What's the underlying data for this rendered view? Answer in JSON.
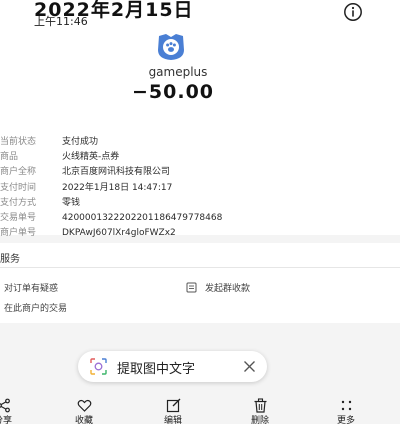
{
  "viewer": {
    "date": "2022年2月15日",
    "time": "上午11:46",
    "info_icon": "info-icon"
  },
  "receipt": {
    "merchant_name": "gameplus",
    "amount": "−50.00",
    "logo_color": "#4a7fd4",
    "rows": [
      {
        "label": "当前状态",
        "value": "支付成功"
      },
      {
        "label": "商品",
        "value": "火线精英-点券"
      },
      {
        "label": "商户全称",
        "value": "北京百度网讯科技有限公司"
      },
      {
        "label": "支付时间",
        "value": "2022年1月18日 14:47:17"
      },
      {
        "label": "支付方式",
        "value": "零钱"
      },
      {
        "label": "交易单号",
        "value": "4200001322202201186479778468"
      },
      {
        "label": "商户单号",
        "value": "DKPAwJ607lXr4gloFWZx2"
      }
    ]
  },
  "service": {
    "title": "服务",
    "items": [
      {
        "label": "对订单有疑惑",
        "icon": "question-icon"
      },
      {
        "label": "发起群收款",
        "icon": "group-receipt-icon"
      },
      {
        "label": "在此商户的交易",
        "icon": "store-icon"
      }
    ]
  },
  "ocr": {
    "label": "提取图中文字",
    "icon": "text-scan-icon",
    "close_icon": "close-icon"
  },
  "toolbar": {
    "items": [
      {
        "label": "分享",
        "icon": "share-icon"
      },
      {
        "label": "收藏",
        "icon": "heart-icon"
      },
      {
        "label": "编辑",
        "icon": "edit-icon"
      },
      {
        "label": "删除",
        "icon": "trash-icon"
      },
      {
        "label": "更多",
        "icon": "more-icon"
      }
    ]
  }
}
